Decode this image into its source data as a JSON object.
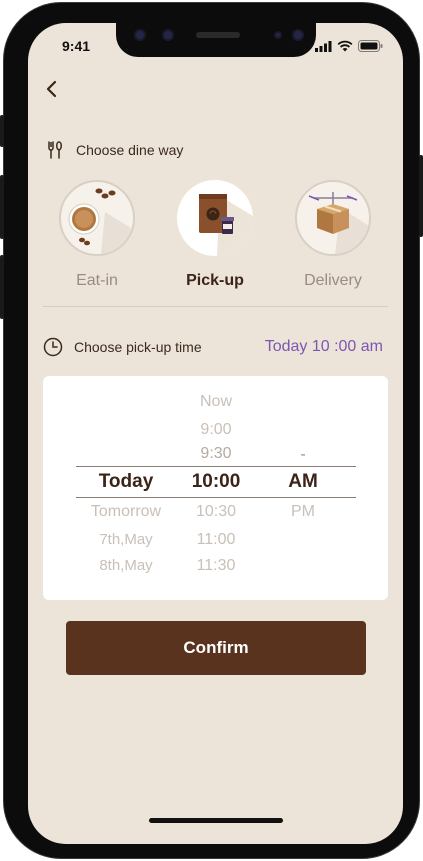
{
  "status_bar": {
    "time": "9:41"
  },
  "header": {
    "back_icon": "chevron-left-icon"
  },
  "dine_way": {
    "title": "Choose dine way",
    "icon": "utensils-icon",
    "options": [
      {
        "label": "Eat-in",
        "icon": "coffee-cup-icon",
        "active": false
      },
      {
        "label": "Pick-up",
        "icon": "takeaway-bag-icon",
        "active": true
      },
      {
        "label": "Delivery",
        "icon": "drone-delivery-icon",
        "active": false
      }
    ]
  },
  "pickup_time": {
    "title": "Choose pick-up time",
    "icon": "clock-icon",
    "selected": "Today 10 :00 am"
  },
  "picker": {
    "day": {
      "above": [],
      "selected": "Today",
      "below": [
        "Tomorrow",
        "7th,May",
        "8th,May"
      ]
    },
    "time": {
      "above": [
        "Now",
        "9:00",
        "9:30"
      ],
      "selected": "10:00",
      "below": [
        "10:30",
        "11:00",
        "11:30"
      ]
    },
    "period": {
      "above": [
        "-"
      ],
      "selected": "AM",
      "below": [
        "PM"
      ]
    }
  },
  "confirm_label": "Confirm",
  "colors": {
    "background": "#ece4d8",
    "accent": "#5a331f",
    "time_highlight": "#7d55b3"
  }
}
